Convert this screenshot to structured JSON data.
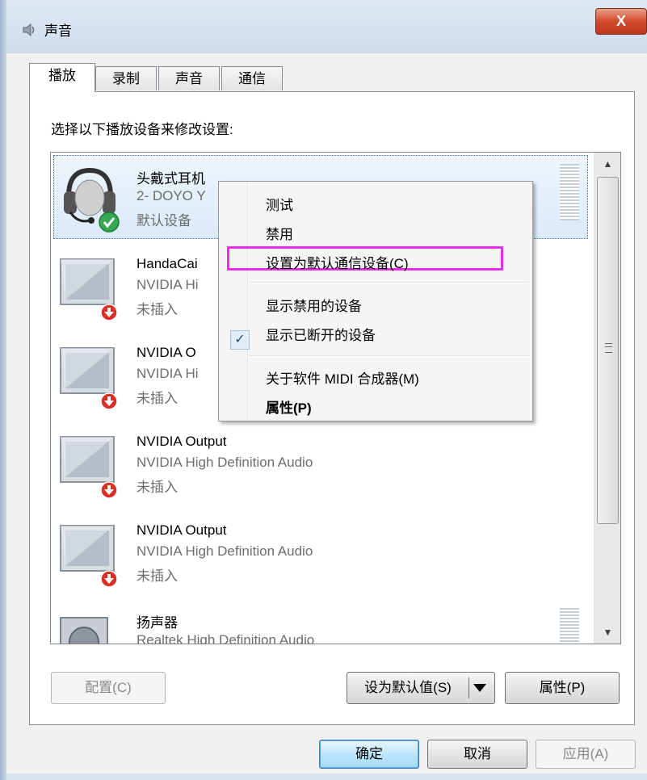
{
  "window": {
    "title": "声音",
    "close_label": "X"
  },
  "tabs": [
    {
      "label": "播放",
      "active": true
    },
    {
      "label": "录制",
      "active": false
    },
    {
      "label": "声音",
      "active": false
    },
    {
      "label": "通信",
      "active": false
    }
  ],
  "instruction": "选择以下播放设备来修改设置:",
  "devices": [
    {
      "name": "头戴式耳机",
      "sub": "2- DOYO Y",
      "status": "默认设备",
      "icon": "headset-icon",
      "badge": "green-check",
      "selected": true
    },
    {
      "name": "HandaCai",
      "sub": "NVIDIA Hi",
      "status": "未插入",
      "icon": "monitor-icon",
      "badge": "red-down-arrow"
    },
    {
      "name": "NVIDIA O",
      "sub": "NVIDIA Hi",
      "status": "未插入",
      "icon": "monitor-icon",
      "badge": "red-down-arrow"
    },
    {
      "name": "NVIDIA Output",
      "sub": "NVIDIA High Definition Audio",
      "status": "未插入",
      "icon": "monitor-icon",
      "badge": "red-down-arrow"
    },
    {
      "name": "NVIDIA Output",
      "sub": "NVIDIA High Definition Audio",
      "status": "未插入",
      "icon": "monitor-icon",
      "badge": "red-down-arrow"
    },
    {
      "name": "扬声器",
      "sub": "Realtek High Definition Audio",
      "status": "",
      "icon": "speaker-icon"
    }
  ],
  "context_menu": {
    "test": "测试",
    "disable": "禁用",
    "set_default_comm": "设置为默认通信设备(C)",
    "show_disabled": "显示禁用的设备",
    "show_disconnected": "显示已断开的设备",
    "check_glyph": "✓",
    "about_midi": "关于软件 MIDI 合成器(M)",
    "properties": "属性(P)"
  },
  "buttons": {
    "configure": "配置(C)",
    "set_default": "设为默认值(S)",
    "properties": "属性(P)",
    "ok": "确定",
    "cancel": "取消",
    "apply": "应用(A)"
  },
  "colors": {
    "highlight_box": "#e62ee6",
    "close_button": "#c9452b",
    "selection_border": "#3a6ea5"
  }
}
